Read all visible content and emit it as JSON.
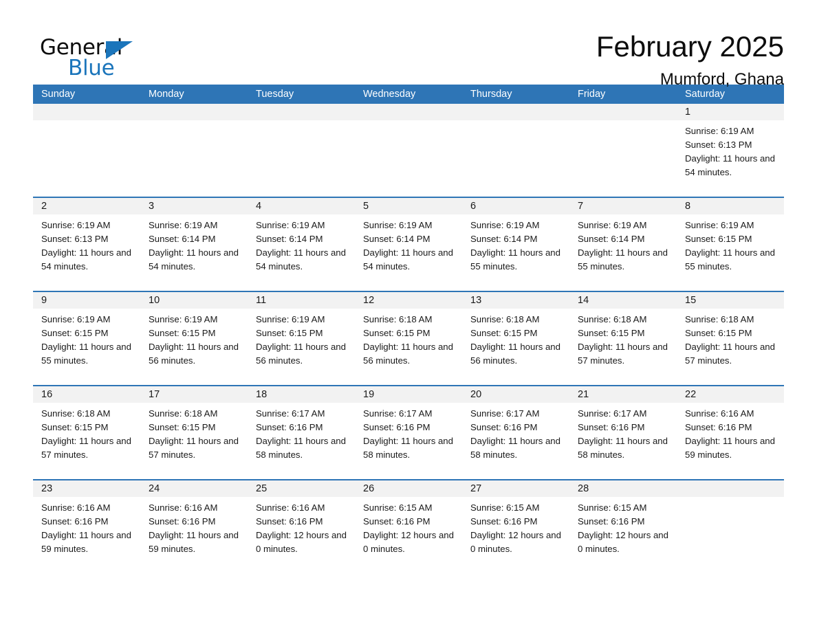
{
  "brand": {
    "word1": "General",
    "word2": "Blue",
    "accent_color": "#1b75bb"
  },
  "header": {
    "title": "February 2025",
    "subtitle": "Mumford, Ghana"
  },
  "calendar": {
    "header_bg": "#2e75b6",
    "row_border": "#2e75b6",
    "daynum_bg": "#f2f2f2",
    "weekdays": [
      "Sunday",
      "Monday",
      "Tuesday",
      "Wednesday",
      "Thursday",
      "Friday",
      "Saturday"
    ],
    "weeks": [
      [
        {
          "empty": true
        },
        {
          "empty": true
        },
        {
          "empty": true
        },
        {
          "empty": true
        },
        {
          "empty": true
        },
        {
          "empty": true
        },
        {
          "day": "1",
          "sunrise": "Sunrise: 6:19 AM",
          "sunset": "Sunset: 6:13 PM",
          "daylight": "Daylight: 11 hours and 54 minutes."
        }
      ],
      [
        {
          "day": "2",
          "sunrise": "Sunrise: 6:19 AM",
          "sunset": "Sunset: 6:13 PM",
          "daylight": "Daylight: 11 hours and 54 minutes."
        },
        {
          "day": "3",
          "sunrise": "Sunrise: 6:19 AM",
          "sunset": "Sunset: 6:14 PM",
          "daylight": "Daylight: 11 hours and 54 minutes."
        },
        {
          "day": "4",
          "sunrise": "Sunrise: 6:19 AM",
          "sunset": "Sunset: 6:14 PM",
          "daylight": "Daylight: 11 hours and 54 minutes."
        },
        {
          "day": "5",
          "sunrise": "Sunrise: 6:19 AM",
          "sunset": "Sunset: 6:14 PM",
          "daylight": "Daylight: 11 hours and 54 minutes."
        },
        {
          "day": "6",
          "sunrise": "Sunrise: 6:19 AM",
          "sunset": "Sunset: 6:14 PM",
          "daylight": "Daylight: 11 hours and 55 minutes."
        },
        {
          "day": "7",
          "sunrise": "Sunrise: 6:19 AM",
          "sunset": "Sunset: 6:14 PM",
          "daylight": "Daylight: 11 hours and 55 minutes."
        },
        {
          "day": "8",
          "sunrise": "Sunrise: 6:19 AM",
          "sunset": "Sunset: 6:15 PM",
          "daylight": "Daylight: 11 hours and 55 minutes."
        }
      ],
      [
        {
          "day": "9",
          "sunrise": "Sunrise: 6:19 AM",
          "sunset": "Sunset: 6:15 PM",
          "daylight": "Daylight: 11 hours and 55 minutes."
        },
        {
          "day": "10",
          "sunrise": "Sunrise: 6:19 AM",
          "sunset": "Sunset: 6:15 PM",
          "daylight": "Daylight: 11 hours and 56 minutes."
        },
        {
          "day": "11",
          "sunrise": "Sunrise: 6:19 AM",
          "sunset": "Sunset: 6:15 PM",
          "daylight": "Daylight: 11 hours and 56 minutes."
        },
        {
          "day": "12",
          "sunrise": "Sunrise: 6:18 AM",
          "sunset": "Sunset: 6:15 PM",
          "daylight": "Daylight: 11 hours and 56 minutes."
        },
        {
          "day": "13",
          "sunrise": "Sunrise: 6:18 AM",
          "sunset": "Sunset: 6:15 PM",
          "daylight": "Daylight: 11 hours and 56 minutes."
        },
        {
          "day": "14",
          "sunrise": "Sunrise: 6:18 AM",
          "sunset": "Sunset: 6:15 PM",
          "daylight": "Daylight: 11 hours and 57 minutes."
        },
        {
          "day": "15",
          "sunrise": "Sunrise: 6:18 AM",
          "sunset": "Sunset: 6:15 PM",
          "daylight": "Daylight: 11 hours and 57 minutes."
        }
      ],
      [
        {
          "day": "16",
          "sunrise": "Sunrise: 6:18 AM",
          "sunset": "Sunset: 6:15 PM",
          "daylight": "Daylight: 11 hours and 57 minutes."
        },
        {
          "day": "17",
          "sunrise": "Sunrise: 6:18 AM",
          "sunset": "Sunset: 6:15 PM",
          "daylight": "Daylight: 11 hours and 57 minutes."
        },
        {
          "day": "18",
          "sunrise": "Sunrise: 6:17 AM",
          "sunset": "Sunset: 6:16 PM",
          "daylight": "Daylight: 11 hours and 58 minutes."
        },
        {
          "day": "19",
          "sunrise": "Sunrise: 6:17 AM",
          "sunset": "Sunset: 6:16 PM",
          "daylight": "Daylight: 11 hours and 58 minutes."
        },
        {
          "day": "20",
          "sunrise": "Sunrise: 6:17 AM",
          "sunset": "Sunset: 6:16 PM",
          "daylight": "Daylight: 11 hours and 58 minutes."
        },
        {
          "day": "21",
          "sunrise": "Sunrise: 6:17 AM",
          "sunset": "Sunset: 6:16 PM",
          "daylight": "Daylight: 11 hours and 58 minutes."
        },
        {
          "day": "22",
          "sunrise": "Sunrise: 6:16 AM",
          "sunset": "Sunset: 6:16 PM",
          "daylight": "Daylight: 11 hours and 59 minutes."
        }
      ],
      [
        {
          "day": "23",
          "sunrise": "Sunrise: 6:16 AM",
          "sunset": "Sunset: 6:16 PM",
          "daylight": "Daylight: 11 hours and 59 minutes."
        },
        {
          "day": "24",
          "sunrise": "Sunrise: 6:16 AM",
          "sunset": "Sunset: 6:16 PM",
          "daylight": "Daylight: 11 hours and 59 minutes."
        },
        {
          "day": "25",
          "sunrise": "Sunrise: 6:16 AM",
          "sunset": "Sunset: 6:16 PM",
          "daylight": "Daylight: 12 hours and 0 minutes."
        },
        {
          "day": "26",
          "sunrise": "Sunrise: 6:15 AM",
          "sunset": "Sunset: 6:16 PM",
          "daylight": "Daylight: 12 hours and 0 minutes."
        },
        {
          "day": "27",
          "sunrise": "Sunrise: 6:15 AM",
          "sunset": "Sunset: 6:16 PM",
          "daylight": "Daylight: 12 hours and 0 minutes."
        },
        {
          "day": "28",
          "sunrise": "Sunrise: 6:15 AM",
          "sunset": "Sunset: 6:16 PM",
          "daylight": "Daylight: 12 hours and 0 minutes."
        },
        {
          "empty": true
        }
      ]
    ]
  }
}
